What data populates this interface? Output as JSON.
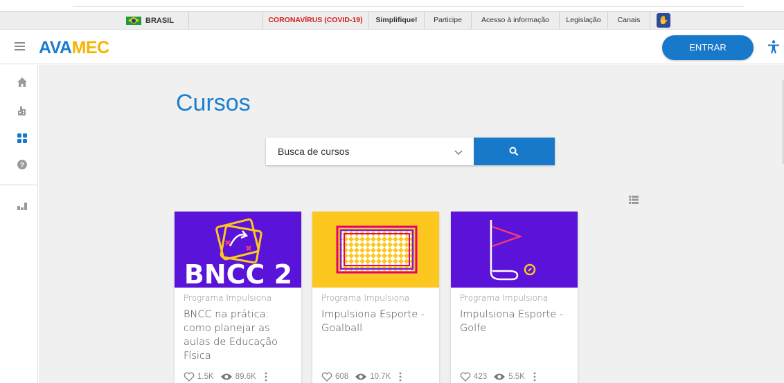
{
  "gov_bar": {
    "country": "BRASIL",
    "links": [
      "CORONAVÍRUS (COVID-19)",
      "Simplifique!",
      "Participe",
      "Acesso à informação",
      "Legislação",
      "Canais"
    ]
  },
  "header": {
    "logo_part1": "AVA",
    "logo_part2": "MEC",
    "login_label": "ENTRAR"
  },
  "sidebar": {
    "icons": [
      "home-icon",
      "institution-icon",
      "courses-grid-icon",
      "help-icon",
      "stats-icon"
    ]
  },
  "main": {
    "title": "Cursos",
    "search": {
      "placeholder": "Busca de cursos"
    }
  },
  "courses": [
    {
      "program": "Programa Impulsiona",
      "title": "BNCC na prática: como planejar as aulas de Educação Física",
      "image_text": "BNCC 2",
      "likes": "1.5K",
      "views": "89.6K",
      "image_color": "#5a13d8"
    },
    {
      "program": "Programa Impulsiona",
      "title": "Impulsiona Esporte - Goalball",
      "likes": "608",
      "views": "10.7K",
      "image_color": "#fcc81f"
    },
    {
      "program": "Programa Impulsiona",
      "title": "Impulsiona Esporte - Golfe",
      "likes": "423",
      "views": "5.5K",
      "image_color": "#5b12d9"
    }
  ],
  "colors": {
    "primary": "#1878c9",
    "accent": "#f7b500",
    "covid": "#d21d1d"
  }
}
